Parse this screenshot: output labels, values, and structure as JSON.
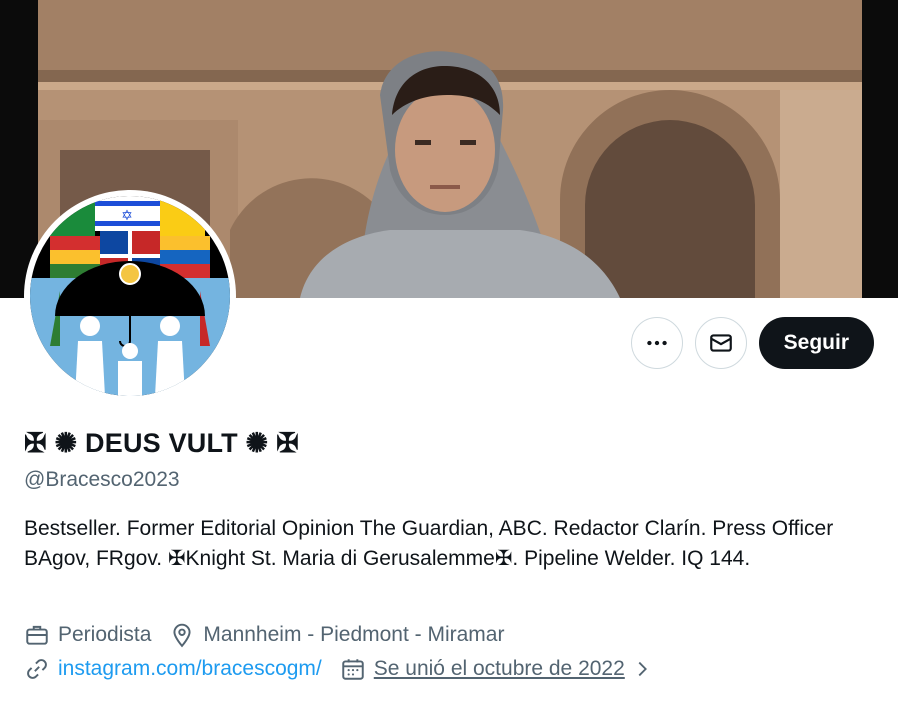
{
  "profile": {
    "display_name": "✠ ✺ DEUS VULT ✺ ✠",
    "handle": "@Bracesco2023",
    "bio": "Bestseller. Former Editorial Opinion The Guardian, ABC. Redactor Clarín. Press Officer BAgov, FRgov. ✠Knight St. Maria di Gerusalemme✠. Pipeline Welder. IQ 144.",
    "profession": "Periodista",
    "location": "Mannheim - Piedmont - Miramar",
    "website": "instagram.com/bracescogm/",
    "joined": "Se unió el octubre de 2022"
  },
  "actions": {
    "follow_label": "Seguir",
    "more_icon": "more-horizontal-icon",
    "message_icon": "envelope-icon"
  },
  "icons": {
    "profession": "briefcase-icon",
    "location": "map-pin-icon",
    "website": "link-icon",
    "joined": "calendar-icon",
    "joined_chevron": "chevron-right-icon"
  },
  "colors": {
    "text_primary": "#0f1419",
    "text_secondary": "#536471",
    "link": "#1d9bf0",
    "button_dark": "#0f1419",
    "border": "#cfd9de"
  }
}
